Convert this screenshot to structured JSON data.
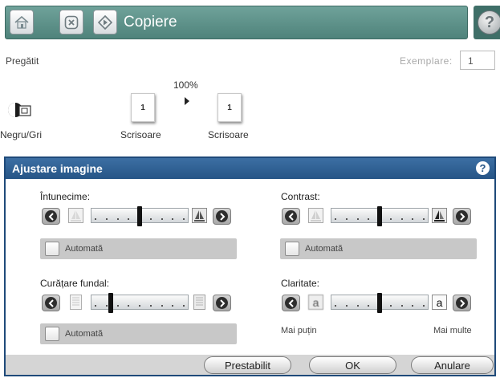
{
  "header": {
    "title": "Copiere",
    "home_icon": "home-icon",
    "stop_icon": "stop-icon",
    "start_icon": "start-icon",
    "help_icon": "help-icon",
    "help_glyph": "?"
  },
  "status": {
    "state": "Pregătit",
    "copies_label": "Exemplare:",
    "copies_value": "1"
  },
  "copy_summary": {
    "scale": "100%",
    "color_mode": "Negru/Gri",
    "original": {
      "number": "1",
      "size": "Scrisoare"
    },
    "output": {
      "number": "1",
      "size": "Scrisoare"
    }
  },
  "dialog": {
    "title": "Ajustare imagine",
    "help_glyph": "?",
    "darkness": {
      "label": "Întunecime:",
      "level": 0.5,
      "auto_label": "Automată"
    },
    "contrast": {
      "label": "Contrast:",
      "level": 0.5,
      "auto_label": "Automată"
    },
    "background_cleanup": {
      "label": "Curățare fundal:",
      "level": 0.18,
      "auto_label": "Automată"
    },
    "sharpness": {
      "label": "Claritate:",
      "level": 0.5,
      "low_label": "Mai puțin",
      "high_label": "Mai multe",
      "end_glyph": "a"
    },
    "buttons": {
      "default": "Prestabilit",
      "ok": "OK",
      "cancel": "Anulare"
    }
  },
  "colors": {
    "header_teal": "#5a8e86",
    "dialog_blue": "#265586",
    "slider_thumb": "#111111"
  }
}
